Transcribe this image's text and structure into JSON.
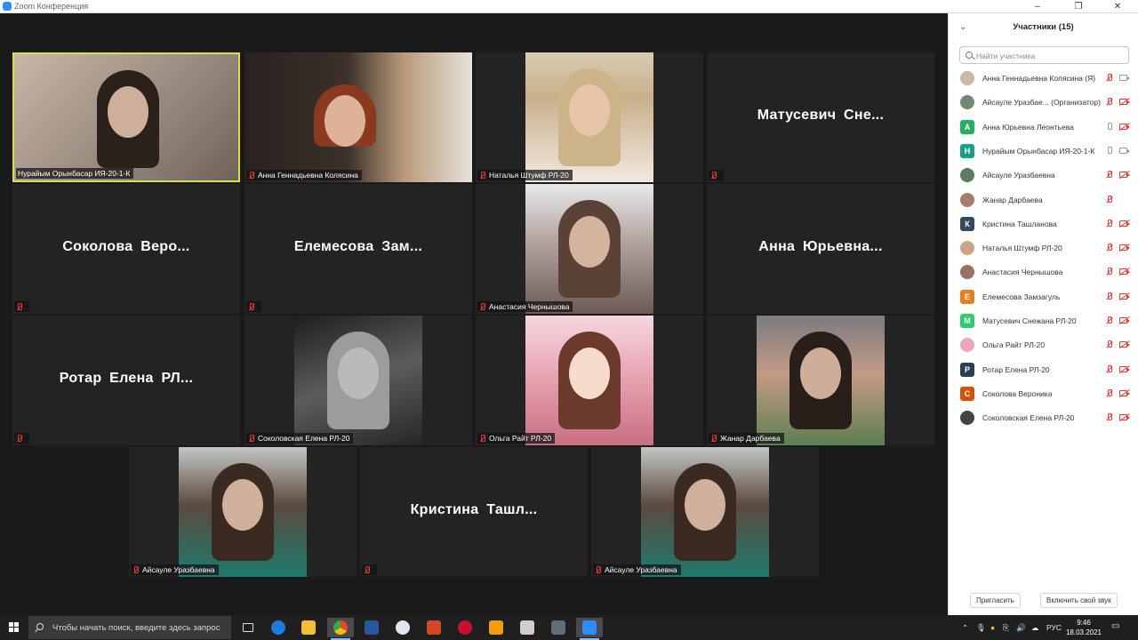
{
  "window": {
    "title": "Zoom Конференция"
  },
  "gallery": {
    "tiles": [
      {
        "name": "Нурайым Орынбасар ИЯ-20-1-К",
        "muted": false,
        "active": true
      },
      {
        "name": "Анна Геннадьевна Колясина",
        "muted": true
      },
      {
        "name": "Наталья Штумф РЛ-20",
        "muted": true
      },
      {
        "name": "Матусевич Снежана РЛ-20",
        "display": "Матусевич Сне...",
        "muted": true
      },
      {
        "name": "Соколова Вероника",
        "display": "Соколова Веро...",
        "muted": true
      },
      {
        "name": "Елемесова Замзагуль",
        "display": "Елемесова Зам...",
        "muted": true
      },
      {
        "name": "Анастасия Чернышова",
        "muted": true
      },
      {
        "name": "Анна Юрьевна Леонтьева",
        "display": "Анна Юрьевна...",
        "muted": true
      },
      {
        "name": "Ротар Елена РЛ-20",
        "display": "Ротар Елена РЛ...",
        "muted": true
      },
      {
        "name": "Соколовская Елена РЛ-20",
        "muted": true
      },
      {
        "name": "Ольга Райт РЛ-20",
        "muted": true
      },
      {
        "name": "Жанар Дарбаева",
        "muted": true
      },
      {
        "name": "Айсауле Уразбаевна",
        "muted": true
      },
      {
        "name": "Кристина Ташланова",
        "display": "Кристина Ташл...",
        "muted": true
      },
      {
        "name": "Айсауле Уразбаевна",
        "muted": true
      }
    ]
  },
  "panel": {
    "title": "Участники (15)",
    "search_placeholder": "Найти участника",
    "participants": [
      {
        "name": "Анна Геннадьевна Колясина (Я)",
        "avatar": "",
        "color": "#c9b6a6",
        "mic": "off",
        "cam": "on"
      },
      {
        "name": "Айсауле Уразбае... (Организатор)",
        "avatar": "",
        "color": "#6f8a70",
        "mic": "off",
        "cam": "off"
      },
      {
        "name": "Анна Юрьевна Леонтьева",
        "avatar": "А",
        "color": "#27ae60",
        "mic": "on",
        "cam": "off"
      },
      {
        "name": "Нурайым Орынбасар ИЯ-20-1-К",
        "avatar": "Н",
        "color": "#16a085",
        "mic": "on",
        "cam": "on"
      },
      {
        "name": "Айсауле Уразбаевна",
        "avatar": "",
        "color": "#5c7a60",
        "mic": "off",
        "cam": "off"
      },
      {
        "name": "Жанар Дарбаева",
        "avatar": "",
        "color": "#a87c6a",
        "mic": "off",
        "cam": "none"
      },
      {
        "name": "Кристина Ташланова",
        "avatar": "К",
        "color": "#34495e",
        "mic": "off",
        "cam": "off"
      },
      {
        "name": "Наталья Штумф РЛ-20",
        "avatar": "",
        "color": "#c8a58a",
        "mic": "off",
        "cam": "off"
      },
      {
        "name": "Анастасия Чернышова",
        "avatar": "",
        "color": "#9b6f64",
        "mic": "off",
        "cam": "off"
      },
      {
        "name": "Елемесова Замзагуль",
        "avatar": "Е",
        "color": "#e67e22",
        "mic": "off",
        "cam": "off"
      },
      {
        "name": "Матусевич Снежана РЛ-20",
        "avatar": "М",
        "color": "#2ecc71",
        "mic": "off",
        "cam": "off"
      },
      {
        "name": "Ольга Райт РЛ-20",
        "avatar": "",
        "color": "#e8a8b8",
        "mic": "off",
        "cam": "off"
      },
      {
        "name": "Ротар Елена РЛ-20",
        "avatar": "Р",
        "color": "#2c3e50",
        "mic": "off",
        "cam": "off"
      },
      {
        "name": "Соколова Вероника",
        "avatar": "С",
        "color": "#d35400",
        "mic": "off",
        "cam": "off"
      },
      {
        "name": "Соколовская Елена РЛ-20",
        "avatar": "",
        "color": "#444444",
        "mic": "off",
        "cam": "off"
      }
    ],
    "invite_label": "Пригласить",
    "unmute_label": "Включить свой звук"
  },
  "taskbar": {
    "search_text": "Чтобы начать поиск, введите здесь запрос",
    "lang": "РУС",
    "time": "9:46",
    "date": "18.03.2021"
  }
}
